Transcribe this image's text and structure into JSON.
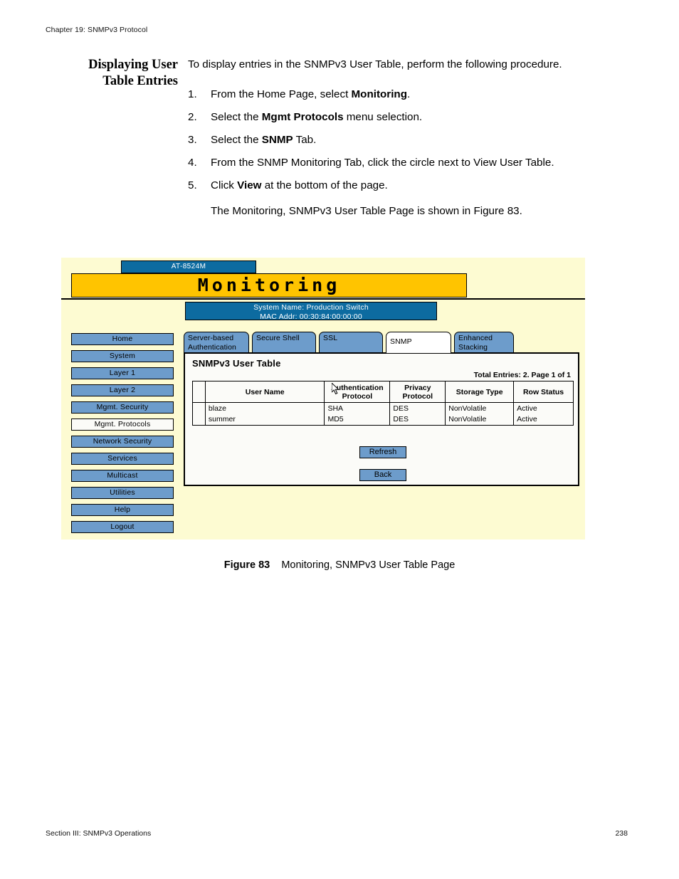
{
  "page": {
    "running_head": "Chapter 19: SNMPv3 Protocol",
    "footer_section": "Section III: SNMPv3 Operations",
    "footer_page_number": "238"
  },
  "section": {
    "heading_line1": "Displaying User",
    "heading_line2": "Table Entries",
    "intro": "To display entries in the SNMPv3 User Table, perform the following procedure.",
    "steps": [
      {
        "num": "1.",
        "pre": "From the Home Page, select ",
        "bold": "Monitoring",
        "post": "."
      },
      {
        "num": "2.",
        "pre": "Select the ",
        "bold": "Mgmt Protocols",
        "post": " menu selection."
      },
      {
        "num": "3.",
        "pre": "Select the ",
        "bold": "SNMP",
        "post": " Tab."
      },
      {
        "num": "4.",
        "pre": "From the SNMP Monitoring Tab, click the circle next to View User Table.",
        "bold": "",
        "post": ""
      },
      {
        "num": "5.",
        "pre": "Click ",
        "bold": "View",
        "post": " at the bottom of the page."
      }
    ],
    "follow_text": "The Monitoring, SNMPv3 User Table Page is shown in Figure 83."
  },
  "figure": {
    "caption_label": "Figure 83",
    "caption_text": "Monitoring, SNMPv3 User Table Page",
    "device_label": "AT-8524M",
    "page_title": "Monitoring",
    "system_name": "System Name: Production Switch",
    "mac_addr": "MAC Addr: 00:30:84:00:00:00",
    "colors": {
      "banner_blue": "#0d6ba0",
      "title_yellow": "#ffc400",
      "button_blue": "#6d9ccb",
      "page_background": "#fdfbd2",
      "panel_background": "#fbfbf8"
    },
    "sidebar": [
      {
        "label": "Home",
        "selected": false
      },
      {
        "label": "System",
        "selected": false
      },
      {
        "label": "Layer 1",
        "selected": false
      },
      {
        "label": "Layer 2",
        "selected": false
      },
      {
        "label": "Mgmt. Security",
        "selected": false
      },
      {
        "label": "Mgmt. Protocols",
        "selected": true
      },
      {
        "label": "Network Security",
        "selected": false
      },
      {
        "label": "Services",
        "selected": false
      },
      {
        "label": "Multicast",
        "selected": false
      },
      {
        "label": "Utilities",
        "selected": false
      },
      {
        "label": "Help",
        "selected": false
      },
      {
        "label": "Logout",
        "selected": false
      }
    ],
    "tabs": [
      {
        "label": "Server-based\nAuthentication",
        "active": false
      },
      {
        "label": "Secure Shell",
        "active": false
      },
      {
        "label": "SSL",
        "active": false
      },
      {
        "label": "SNMP",
        "active": true
      },
      {
        "label": "Enhanced\nStacking",
        "active": false
      }
    ],
    "panel": {
      "title": "SNMPv3 User Table",
      "entries_note": "Total Entries: 2. Page 1 of 1",
      "columns": [
        "",
        "User Name",
        "Authentication\nProtocol",
        "Privacy\nProtocol",
        "Storage Type",
        "Row Status"
      ],
      "rows": [
        {
          "user_name": "blaze",
          "auth_protocol": "SHA",
          "privacy_protocol": "DES",
          "storage_type": "NonVolatile",
          "row_status": "Active"
        },
        {
          "user_name": "summer",
          "auth_protocol": "MD5",
          "privacy_protocol": "DES",
          "storage_type": "NonVolatile",
          "row_status": "Active"
        }
      ],
      "buttons": {
        "refresh": "Refresh",
        "back": "Back"
      }
    }
  }
}
